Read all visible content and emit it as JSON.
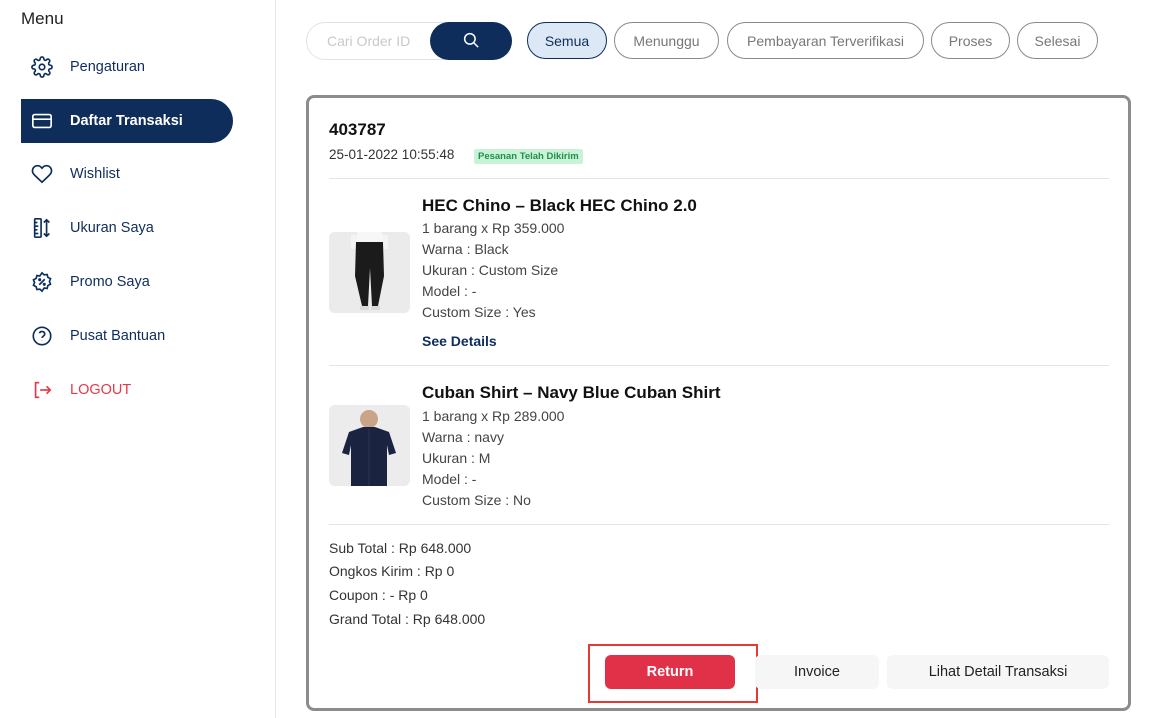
{
  "sidebar": {
    "title": "Menu",
    "items": [
      {
        "label": "Pengaturan",
        "icon": "gear-icon"
      },
      {
        "label": "Daftar Transaksi",
        "icon": "card-icon",
        "active": true
      },
      {
        "label": "Wishlist",
        "icon": "heart-icon"
      },
      {
        "label": "Ukuran Saya",
        "icon": "ruler-icon"
      },
      {
        "label": "Promo Saya",
        "icon": "promo-badge-icon"
      },
      {
        "label": "Pusat Bantuan",
        "icon": "help-icon"
      },
      {
        "label": "LOGOUT",
        "icon": "logout-icon"
      }
    ]
  },
  "search": {
    "placeholder": "Cari Order ID",
    "value": ""
  },
  "filters": [
    "Semua",
    "Menunggu",
    "Pembayaran Terverifikasi",
    "Proses",
    "Selesai"
  ],
  "active_filter": "Semua",
  "order": {
    "id": "403787",
    "date": "25-01-2022 10:55:48",
    "status": "Pesanan Telah Dikirim",
    "products": [
      {
        "name": "HEC Chino – Black HEC Chino 2.0",
        "qty_price": "1 barang x Rp 359.000",
        "color": "Warna : Black",
        "size": "Ukuran : Custom Size",
        "model": "Model : -",
        "custom": "Custom Size : Yes",
        "details_link": "See Details"
      },
      {
        "name": "Cuban Shirt – Navy Blue Cuban Shirt",
        "qty_price": "1 barang x Rp 289.000",
        "color": "Warna : navy",
        "size": "Ukuran : M",
        "model": "Model : -",
        "custom": "Custom Size : No"
      }
    ],
    "sub_total": "Sub Total : Rp 648.000",
    "shipping": "Ongkos Kirim : Rp 0",
    "coupon": "Coupon : - Rp 0",
    "grand_total": "Grand Total : Rp 648.000",
    "buttons": {
      "return": "Return",
      "invoice": "Invoice",
      "detail": "Lihat Detail Transaksi"
    }
  },
  "colors": {
    "primary": "#0e2d5b",
    "danger": "#e03148",
    "status_bg": "#c9f3d8",
    "status_text": "#1f8f4a"
  }
}
